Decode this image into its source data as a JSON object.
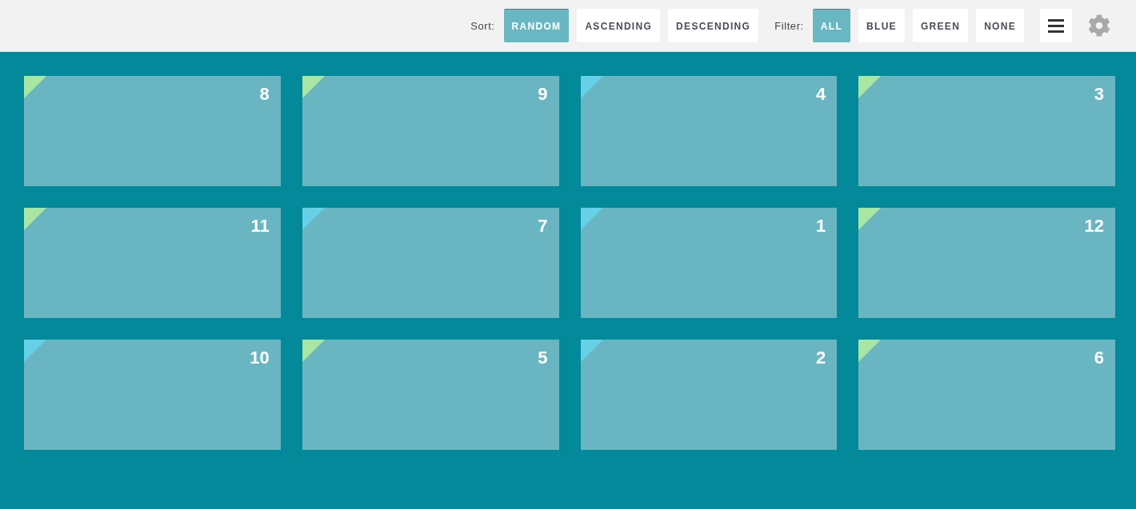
{
  "toolbar": {
    "sort": {
      "label": "Sort:",
      "options": [
        {
          "label": "RANDOM",
          "selected": true
        },
        {
          "label": "ASCENDING",
          "selected": false
        },
        {
          "label": "DESCENDING",
          "selected": false
        }
      ]
    },
    "filter": {
      "label": "Filter:",
      "options": [
        {
          "label": "ALL",
          "selected": true
        },
        {
          "label": "BLUE",
          "selected": false
        },
        {
          "label": "GREEN",
          "selected": false
        },
        {
          "label": "NONE",
          "selected": false
        }
      ]
    }
  },
  "cards": [
    {
      "number": "8",
      "color": "#a8e6a3"
    },
    {
      "number": "9",
      "color": "#a8e6a3"
    },
    {
      "number": "4",
      "color": "#68d0e6"
    },
    {
      "number": "3",
      "color": "#a8e6a3"
    },
    {
      "number": "11",
      "color": "#a8e6a3"
    },
    {
      "number": "7",
      "color": "#68d0e6"
    },
    {
      "number": "1",
      "color": "#68d0e6"
    },
    {
      "number": "12",
      "color": "#a8e6a3"
    },
    {
      "number": "10",
      "color": "#68d0e6"
    },
    {
      "number": "5",
      "color": "#a8e6a3"
    },
    {
      "number": "2",
      "color": "#68d0e6"
    },
    {
      "number": "6",
      "color": "#a8e6a3"
    }
  ]
}
